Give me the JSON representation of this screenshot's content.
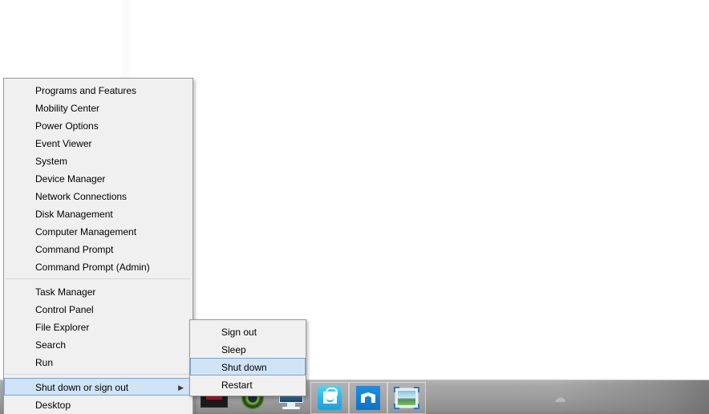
{
  "desktop": {
    "background_color": "#ffffff"
  },
  "power_user_menu": {
    "name": "Win+X power user menu",
    "groups": [
      {
        "items": [
          {
            "label": "Programs and Features",
            "selected": false,
            "has_submenu": false
          },
          {
            "label": "Mobility Center",
            "selected": false,
            "has_submenu": false
          },
          {
            "label": "Power Options",
            "selected": false,
            "has_submenu": false
          },
          {
            "label": "Event Viewer",
            "selected": false,
            "has_submenu": false
          },
          {
            "label": "System",
            "selected": false,
            "has_submenu": false
          },
          {
            "label": "Device Manager",
            "selected": false,
            "has_submenu": false
          },
          {
            "label": "Network Connections",
            "selected": false,
            "has_submenu": false
          },
          {
            "label": "Disk Management",
            "selected": false,
            "has_submenu": false
          },
          {
            "label": "Computer Management",
            "selected": false,
            "has_submenu": false
          },
          {
            "label": "Command Prompt",
            "selected": false,
            "has_submenu": false
          },
          {
            "label": "Command Prompt (Admin)",
            "selected": false,
            "has_submenu": false
          }
        ]
      },
      {
        "items": [
          {
            "label": "Task Manager",
            "selected": false,
            "has_submenu": false
          },
          {
            "label": "Control Panel",
            "selected": false,
            "has_submenu": false
          },
          {
            "label": "File Explorer",
            "selected": false,
            "has_submenu": false
          },
          {
            "label": "Search",
            "selected": false,
            "has_submenu": false
          },
          {
            "label": "Run",
            "selected": false,
            "has_submenu": false
          }
        ]
      },
      {
        "items": [
          {
            "label": "Shut down or sign out",
            "selected": true,
            "has_submenu": true,
            "submenu_arrow_glyph": "▶"
          },
          {
            "label": "Desktop",
            "selected": false,
            "has_submenu": false
          }
        ]
      }
    ]
  },
  "shutdown_submenu": {
    "name": "Shut down or sign out submenu",
    "items": [
      {
        "label": "Sign out",
        "selected": false
      },
      {
        "label": "Sleep",
        "selected": false
      },
      {
        "label": "Shut down",
        "selected": true
      },
      {
        "label": "Restart",
        "selected": false
      }
    ]
  },
  "taskbar": {
    "buttons": [
      {
        "icon": "media-player-icon",
        "label": "Media player",
        "framed": false
      },
      {
        "icon": "antivirus-shield-icon",
        "label": "Antivirus",
        "framed": false
      },
      {
        "icon": "desktop-monitor-icon",
        "label": "This PC",
        "framed": false
      },
      {
        "icon": "windows-store-icon",
        "label": "Store",
        "framed": true
      },
      {
        "icon": "maxthon-browser-icon",
        "label": "Maxthon",
        "framed": true
      },
      {
        "icon": "photos-icon",
        "label": "Photos",
        "framed": true
      }
    ],
    "tray_glyph": "☁"
  },
  "colors": {
    "menu_background": "#f0f0f0",
    "menu_border": "#9a9a9a",
    "highlight_fill": "#cfe4f7",
    "highlight_border": "#7da2ce",
    "separator": "#d7d7d7",
    "taskbar_top": "#b4b4b4",
    "taskbar_bottom": "#848484",
    "text": "#000000"
  }
}
